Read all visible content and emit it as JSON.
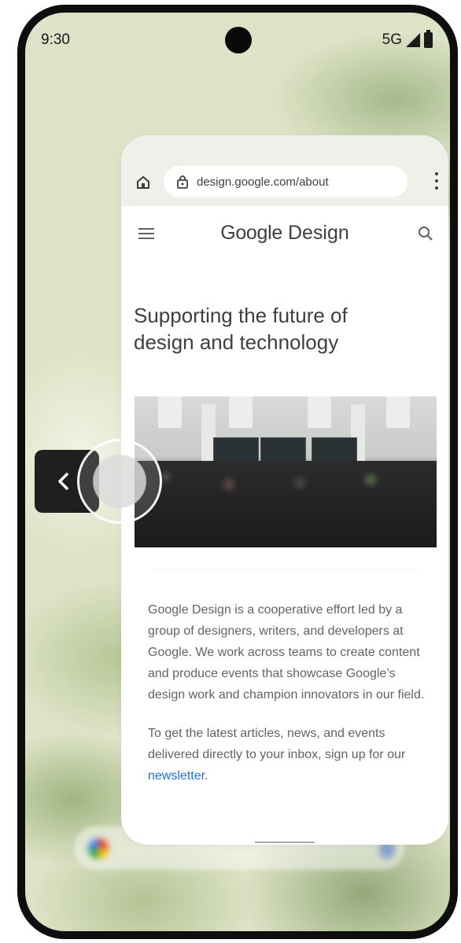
{
  "status_bar": {
    "time": "9:30",
    "network": "5G"
  },
  "browser": {
    "url": "design.google.com/about"
  },
  "site": {
    "logo_google": "Google",
    "logo_design": "Design",
    "headline_line1": "Supporting the future of",
    "headline_line2": "design and technology",
    "paragraph1": "Google Design is a cooperative effort led by a group of designers, writers, and developers at Google. We work across teams to create content and produce events that showcase Google’s design work and champion innovators in our field.",
    "paragraph2_prefix": "To get the latest articles, news, and events delivered directly to your inbox, sign up for our ",
    "paragraph2_link": "newsletter",
    "paragraph2_suffix": "."
  },
  "icons": {
    "home": "home-icon",
    "lock": "lock-icon",
    "menu": "more-vert-icon",
    "hamburger": "hamburger-icon",
    "search": "search-icon",
    "back": "chevron-left-icon"
  },
  "colors": {
    "link": "#1a73e8",
    "text": "#3c4043",
    "wallpaper": "#dde3c6"
  }
}
